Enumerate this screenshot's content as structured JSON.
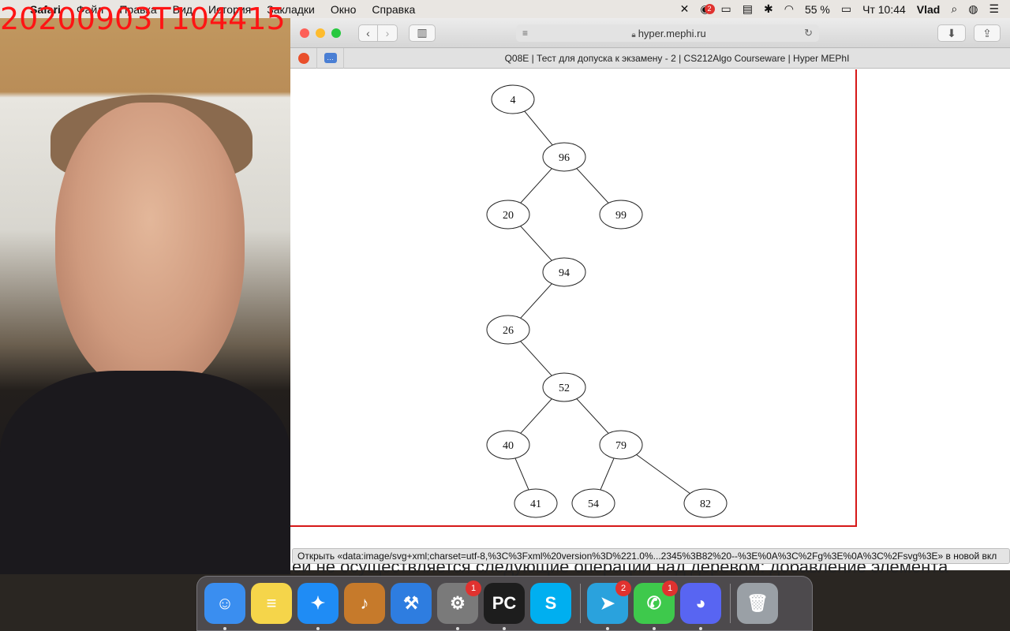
{
  "menubar": {
    "app_name": "Safari",
    "menus": [
      "Файл",
      "Правка",
      "Вид",
      "История",
      "Закладки",
      "Окно",
      "Справка"
    ],
    "battery": "55 %",
    "clock": "Чт 10:44",
    "user": "Vlad",
    "notification_badge": "2"
  },
  "camera": {
    "timestamp": "20200903T104415"
  },
  "browser": {
    "url": "hyper.mephi.ru",
    "tab_title": "Q08E | Тест для допуска к экзамену - 2 | CS212Algo Courseware | Hyper MEPhI",
    "status_text": "Открыть «data:image/svg+xml;charset=utf-8,%3C%3Fxml%20version%3D%221.0%...2345%3B82%20--%3E%0A%3C%2Fg%3E%0A%3C%2Fsvg%3E» в новой вкл",
    "partial_text": "ей не осуществляется следующие операции над деревом: добавление элемента"
  },
  "tree": {
    "nodes": [
      {
        "id": "4",
        "label": "4"
      },
      {
        "id": "96",
        "label": "96"
      },
      {
        "id": "20",
        "label": "20"
      },
      {
        "id": "99",
        "label": "99"
      },
      {
        "id": "94",
        "label": "94"
      },
      {
        "id": "26",
        "label": "26"
      },
      {
        "id": "52",
        "label": "52"
      },
      {
        "id": "40",
        "label": "40"
      },
      {
        "id": "79",
        "label": "79"
      },
      {
        "id": "41",
        "label": "41"
      },
      {
        "id": "54",
        "label": "54"
      },
      {
        "id": "82",
        "label": "82"
      }
    ],
    "edges": [
      [
        "4",
        "96"
      ],
      [
        "96",
        "20"
      ],
      [
        "96",
        "99"
      ],
      [
        "20",
        "94"
      ],
      [
        "94",
        "26"
      ],
      [
        "26",
        "52"
      ],
      [
        "52",
        "40"
      ],
      [
        "52",
        "79"
      ],
      [
        "40",
        "41"
      ],
      [
        "79",
        "54"
      ],
      [
        "79",
        "82"
      ]
    ]
  },
  "dock": {
    "items": [
      {
        "name": "finder-app",
        "icon": "finder-icon",
        "color": "#3a8ef0",
        "badge": ""
      },
      {
        "name": "notes-app",
        "icon": "notes-icon",
        "color": "#f5d54a",
        "badge": ""
      },
      {
        "name": "safari-app",
        "icon": "safari-icon",
        "color": "#1f8cf5",
        "badge": ""
      },
      {
        "name": "garageband-app",
        "icon": "guitar-icon",
        "color": "#c67a2b",
        "badge": ""
      },
      {
        "name": "xcode-app",
        "icon": "hammer-icon",
        "color": "#2e7de0",
        "badge": ""
      },
      {
        "name": "system-preferences-app",
        "icon": "gear-icon",
        "color": "#7a7a7a",
        "badge": "1"
      },
      {
        "name": "pycharm-app",
        "icon": "pycharm-icon",
        "color": "#1d1d1d",
        "badge": ""
      },
      {
        "name": "skype-app",
        "icon": "skype-icon",
        "color": "#00aff0",
        "badge": ""
      },
      {
        "name": "telegram-app",
        "icon": "telegram-icon",
        "color": "#2aa2dd",
        "badge": "2"
      },
      {
        "name": "facetime-app",
        "icon": "facetime-icon",
        "color": "#3ec94c",
        "badge": "1"
      },
      {
        "name": "discord-app",
        "icon": "discord-icon",
        "color": "#5865f2",
        "badge": ""
      },
      {
        "name": "trash",
        "icon": "trash-icon",
        "color": "#9aa0a6",
        "badge": ""
      }
    ]
  }
}
